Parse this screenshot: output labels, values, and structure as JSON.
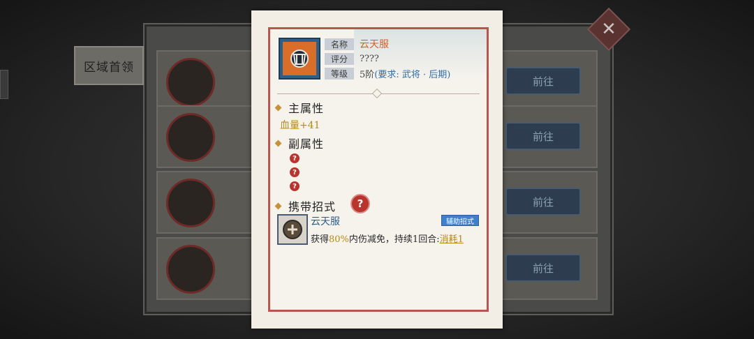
{
  "background": {
    "tab_label": "区域首领",
    "goto_buttons": [
      "前往",
      "前往",
      "前往",
      "前往"
    ]
  },
  "item": {
    "icon": "armor-icon",
    "name_label": "名称",
    "name_value": "云天服",
    "score_label": "评分",
    "score_value": "????",
    "level_label": "等级",
    "level_value": "5阶",
    "level_requirement": "(要求: 武将 · 后期)"
  },
  "main_attr": {
    "title": "主属性",
    "stat": "血量+41"
  },
  "sub_attr": {
    "title": "副属性",
    "unknown": [
      "?",
      "?",
      "?"
    ]
  },
  "carried_skill": {
    "title": "携带招式",
    "help": "?",
    "skill_name": "云天服",
    "badge": "辅助招式",
    "desc_prefix": "获得",
    "desc_highlight": "80%",
    "desc_mid": "内伤减免，持续1回合:",
    "desc_link": "消耗1"
  },
  "colors": {
    "frame_red": "#b7564e",
    "name_orange": "#d2602a",
    "gold": "#b58a14",
    "req_blue": "#2f6fa8"
  }
}
